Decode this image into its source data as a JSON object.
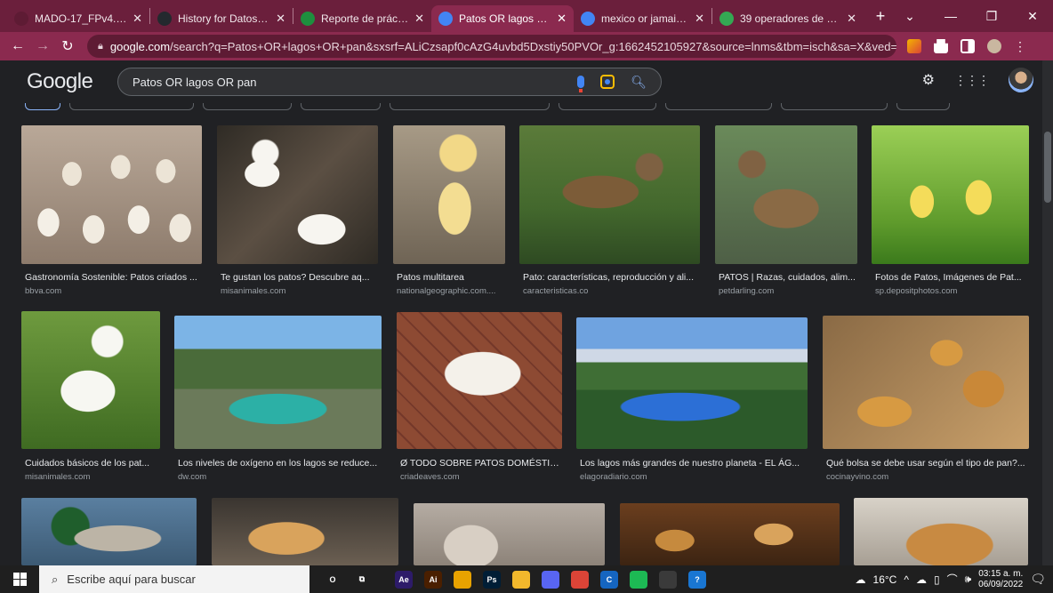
{
  "tabs": [
    {
      "title": "MADO-17_FPv4.pdf",
      "close": "✕",
      "favicon": "document-icon",
      "color": "#5e1b34",
      "w": 160
    },
    {
      "title": "History for DatosAdria",
      "close": "✕",
      "favicon": "github-icon",
      "color": "#24292e",
      "w": 160
    },
    {
      "title": "Reporte de práctica 0",
      "close": "✕",
      "favicon": "classroom-icon",
      "color": "#1e8e3e",
      "w": 155
    },
    {
      "title": "Patos OR lagos OR pa",
      "close": "✕",
      "favicon": "google-icon",
      "color": "#4285f4",
      "w": 160,
      "active": true
    },
    {
      "title": "mexico or jamaica - B",
      "close": "✕",
      "favicon": "google-icon",
      "color": "#4285f4",
      "w": 155
    },
    {
      "title": "39 operadores de bús",
      "close": "✕",
      "favicon": "sparkle-icon",
      "color": "#34a853",
      "w": 170
    }
  ],
  "newtab": "+",
  "window_controls": {
    "dropdown": "⌄",
    "minimize": "—",
    "restore": "❐",
    "close": "✕"
  },
  "address": {
    "host": "google.com",
    "path": "/search?q=Patos+OR+lagos+OR+pan&sxsrf=ALiCzsapf0cAzG4uvbd5Dxstiy50PVOr_g:1662452105927&source=lnms&tbm=isch&sa=X&ved=2ah..."
  },
  "google": {
    "logo": "Google",
    "query": "Patos OR lagos OR pan"
  },
  "results": [
    {
      "caption": "Gastronomía Sostenible: Patos criados ...",
      "source": "bbva.com",
      "img": "ducks-flock"
    },
    {
      "caption": "Te gustan los patos? Descubre aq...",
      "source": "misanimales.com",
      "img": "white-ducks-water"
    },
    {
      "caption": "Patos multitarea",
      "source": "nationalgeographic.com....",
      "img": "duckling"
    },
    {
      "caption": "Pato: características, reproducción y ali...",
      "source": "caracteristicas.co",
      "img": "mallard-pond"
    },
    {
      "caption": "PATOS | Razas, cuidados, alim...",
      "source": "petdarling.com",
      "img": "mallard-female"
    },
    {
      "caption": "Fotos de Patos, Imágenes de Pat...",
      "source": "sp.depositphotos.com",
      "img": "ducklings-grass"
    },
    {
      "caption": "Cuidados básicos de los pat...",
      "source": "misanimales.com",
      "img": "white-duck-grass"
    },
    {
      "caption": "Los niveles de oxígeno en los lagos se reduce...",
      "source": "dw.com",
      "img": "mountain-lake"
    },
    {
      "caption": "Ø TODO SOBRE PATOS DOMÉSTIC...",
      "source": "criadeaves.com",
      "img": "white-duck-bricks"
    },
    {
      "caption": "Los lagos más grandes de nuestro planeta - EL ÁG...",
      "source": "elagoradiario.com",
      "img": "blue-lake"
    },
    {
      "caption": "Qué bolsa se debe usar según el tipo de pan?...",
      "source": "cocinayvino.com",
      "img": "bread-bag"
    },
    {
      "caption": "",
      "source": "",
      "img": "mallard-male"
    },
    {
      "caption": "",
      "source": "",
      "img": "bread-loaf"
    },
    {
      "caption": "",
      "source": "",
      "img": "bread-dough"
    },
    {
      "caption": "",
      "source": "",
      "img": "bread-assortment"
    },
    {
      "caption": "",
      "source": "",
      "img": "bread-round"
    }
  ],
  "taskbar": {
    "search_placeholder": "Escribe aquí para buscar",
    "apps": [
      {
        "name": "cortana-icon",
        "label": "O",
        "color": "transparent"
      },
      {
        "name": "task-view-icon",
        "label": "⧉",
        "color": "transparent"
      },
      {
        "name": "after-effects-icon",
        "label": "Ae",
        "color": "#2d1b69"
      },
      {
        "name": "illustrator-icon",
        "label": "Ai",
        "color": "#4a1f00"
      },
      {
        "name": "chrome-canary-icon",
        "label": "",
        "color": "#e8a200"
      },
      {
        "name": "photoshop-icon",
        "label": "Ps",
        "color": "#001e36"
      },
      {
        "name": "file-explorer-icon",
        "label": "",
        "color": "#f2b82c"
      },
      {
        "name": "discord-icon",
        "label": "",
        "color": "#5865f2"
      },
      {
        "name": "chrome-icon",
        "label": "",
        "color": "#db4437"
      },
      {
        "name": "copilot-icon",
        "label": "C",
        "color": "#1565c0"
      },
      {
        "name": "spotify-icon",
        "label": "",
        "color": "#1db954"
      },
      {
        "name": "vscode-icon",
        "label": "",
        "color": "#3a3a3a"
      },
      {
        "name": "help-icon",
        "label": "?",
        "color": "#1976d2"
      }
    ],
    "weather": "16°C",
    "time": "03:15 a. m.",
    "date": "06/09/2022"
  }
}
